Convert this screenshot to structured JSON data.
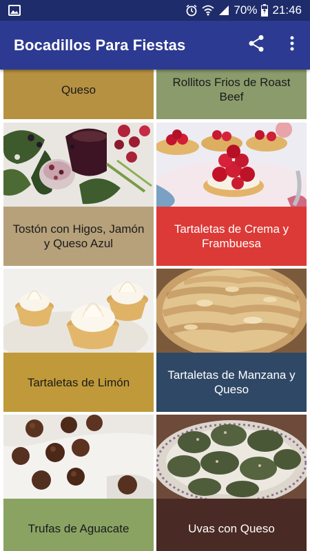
{
  "status_bar": {
    "battery": "70%",
    "time": "21:46",
    "icons": [
      "image-icon",
      "alarm-icon",
      "wifi-icon",
      "signal-icon",
      "battery-icon"
    ]
  },
  "app_bar": {
    "title": "Bocadillos Para Fiestas",
    "icons": [
      "share-icon",
      "more-vert-icon"
    ]
  },
  "items": [
    {
      "label": "Queso",
      "color": "#b79142"
    },
    {
      "label": "Rollitos Frios de Roast Beef",
      "color": "#8b9b6c"
    },
    {
      "label": "Tostón con Higos, Jamón y Queso Azul",
      "color": "#b7a17a"
    },
    {
      "label": "Tartaletas de Crema y Frambuesa",
      "color": "#dc3a37"
    },
    {
      "label": "Tartaletas de Limón",
      "color": "#c09a3a"
    },
    {
      "label": "Tartaletas de Manzana y Queso",
      "color": "#2f4866"
    },
    {
      "label": "Trufas de Aguacate",
      "color": "#8aa363"
    },
    {
      "label": "Uvas con Queso",
      "color": "#4a2a24"
    }
  ]
}
